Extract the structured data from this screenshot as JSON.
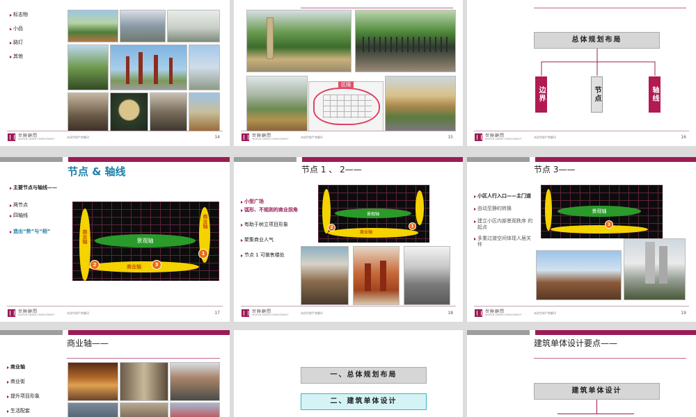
{
  "logo": {
    "cn": "世聯顧問",
    "en": "WORLD UNION CONSULTANCY"
  },
  "slide_note": "未经世联严禁翻印",
  "colors": {
    "accent": "#9b1c55",
    "grey_bar": "#9d9d9d",
    "title_blue": "#1d7fa6",
    "highlight_cyan": "#d4f3f4"
  },
  "s14": {
    "page": "14",
    "bullets": [
      "标志物",
      "小品",
      "路灯",
      "其他"
    ]
  },
  "s15": {
    "page": "15",
    "map_label": "区隔"
  },
  "s16": {
    "page": "16",
    "title": "总体规划布局",
    "labels": [
      "边界",
      "节点",
      "轴线"
    ]
  },
  "s17": {
    "page": "17",
    "title": "节点 & 轴线",
    "bullets": [
      "主要节点与轴线——",
      "两节点",
      "四轴线",
      "造出“势”与“相”"
    ],
    "map": {
      "left_label": "商业轴",
      "right_label": "商业轴",
      "green_label": "景观轴",
      "bottom_label": "商业轴",
      "nodes": [
        "1",
        "2",
        "3"
      ]
    }
  },
  "s18": {
    "page": "18",
    "title": "节点 1 、 2——",
    "bullets": [
      "小型广场",
      "弧形、不规则的商业拐角",
      "有助于树立项目形象",
      "聚集商业人气",
      "节点 1 可做售楼处"
    ],
    "map": {
      "green_label": "景观轴",
      "bottom_label": "商业轴",
      "nodes": [
        "2",
        "1"
      ]
    }
  },
  "s19": {
    "page": "19",
    "title": "节点 3——",
    "bullets": [
      "小区人行入口——主门道",
      "由动至静的转换",
      "建立小区内部景观秩序 的起点",
      "多重过渡空间体现人居关怀"
    ],
    "map": {
      "green_label": "景观轴",
      "nodes": [
        "3"
      ]
    }
  },
  "s20": {
    "title": "商业轴——",
    "bullets": [
      "商业轴",
      "商业街",
      "提升项目形象",
      "生活配套"
    ]
  },
  "s21": {
    "items": [
      "一、总体规划布局",
      "二、建筑单体设计"
    ]
  },
  "s22": {
    "title": "建筑单体设计要点——",
    "box": "建筑单体设计"
  }
}
